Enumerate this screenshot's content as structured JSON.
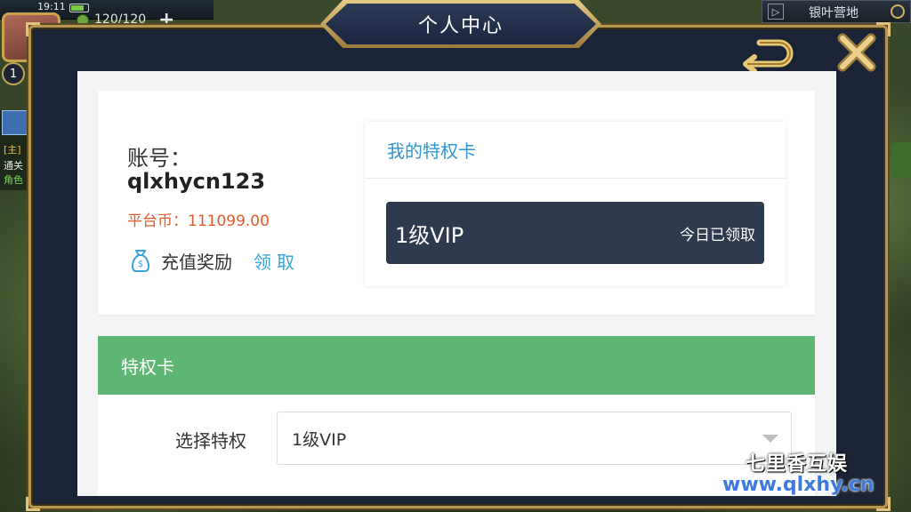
{
  "status_bar": {
    "time": "19:11"
  },
  "hud": {
    "energy": "120/120",
    "level": "1",
    "plus": "+"
  },
  "left_task": {
    "tag": "[主]",
    "line1": "通关",
    "line2": "角色"
  },
  "location": {
    "name": "银叶营地",
    "arrow": "▷"
  },
  "modal": {
    "title": "个人中心"
  },
  "account": {
    "label": "账号：",
    "id": "qlxhycn123",
    "coins": "平台币：111099.00",
    "recharge_label": "充值奖励",
    "claim": "领取"
  },
  "privilege": {
    "header": "我的特权卡",
    "card_level": "1级VIP",
    "card_status": "今日已领取"
  },
  "privilege_section": {
    "title": "特权卡",
    "select_label": "选择特权",
    "select_value": "1级VIP"
  },
  "watermark": {
    "site_cn": "七里香互娱",
    "url": "www.qlxhy.cn"
  },
  "colors": {
    "modal_bg": "#1a2436",
    "gold_border": "#b89650",
    "link_blue": "#2e96d4",
    "coin_orange": "#e05a2a",
    "vip_card": "#2e3a4e",
    "section_green": "#5fb672"
  }
}
